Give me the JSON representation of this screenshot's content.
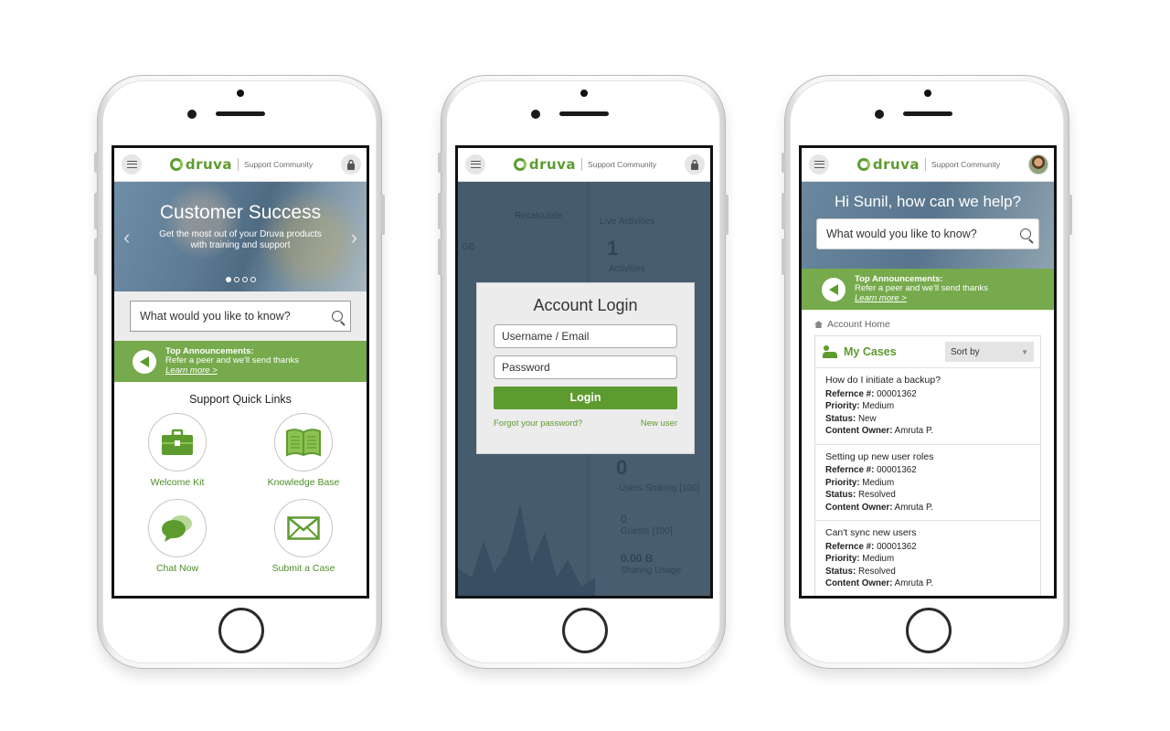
{
  "brand": {
    "logo": "druva",
    "subtitle": "Support Community"
  },
  "colors": {
    "brand_green": "#5e9b2f",
    "announce_green": "#76aa4c"
  },
  "phone1": {
    "hero": {
      "title": "Customer Success",
      "subtitle": "Get the most out of your Druva products with training and support",
      "slide_count": 4,
      "active_slide": 1
    },
    "search": {
      "placeholder": "What would you like to know?"
    },
    "announcement": {
      "title": "Top Announcements:",
      "text": "Refer a peer and we'll send thanks",
      "link": "Learn more >"
    },
    "quick_links": {
      "title": "Support Quick Links",
      "items": [
        {
          "label": "Welcome Kit",
          "icon": "briefcase-icon"
        },
        {
          "label": "Knowledge Base",
          "icon": "open-book-icon"
        },
        {
          "label": "Chat Now",
          "icon": "chat-bubbles-icon"
        },
        {
          "label": "Submit a Case",
          "icon": "envelope-icon"
        }
      ]
    }
  },
  "phone2": {
    "background": {
      "recalculate": "Recalculate",
      "live": "Live Activities",
      "count": "1",
      "activities": "Activities",
      "gb": "GB",
      "zero": "0",
      "users_sharing": "Users Sharing [100]",
      "zero2": "0",
      "guests": "Guests [100]",
      "bytes": "0.00 B",
      "sharing_usage": "Sharing Usage"
    },
    "login": {
      "title": "Account Login",
      "username_placeholder": "Username / Email",
      "password_placeholder": "Password",
      "button": "Login",
      "forgot": "Forgot your password?",
      "new_user": "New user"
    }
  },
  "phone3": {
    "greeting": "Hi Sunil, how can we help?",
    "search": {
      "placeholder": "What would you like to know?"
    },
    "announcement": {
      "title": "Top Announcements:",
      "text": "Refer a peer and we'll send thanks",
      "link": "Learn more >"
    },
    "breadcrumb": "Account Home",
    "cases": {
      "title": "My Cases",
      "sort_label": "Sort by",
      "field_labels": {
        "ref": "Refernce #:",
        "priority": "Priority:",
        "status": "Status:",
        "owner": "Content Owner:"
      },
      "items": [
        {
          "question": "How do I initiate a backup?",
          "ref": "00001362",
          "priority": "Medium",
          "status": "New",
          "owner": "Amruta P."
        },
        {
          "question": "Setting up new user roles",
          "ref": "00001362",
          "priority": "Medium",
          "status": "Resolved",
          "owner": "Amruta P."
        },
        {
          "question": "Can't sync new users",
          "ref": "00001362",
          "priority": "Medium",
          "status": "Resolved",
          "owner": "Amruta P."
        }
      ]
    }
  }
}
